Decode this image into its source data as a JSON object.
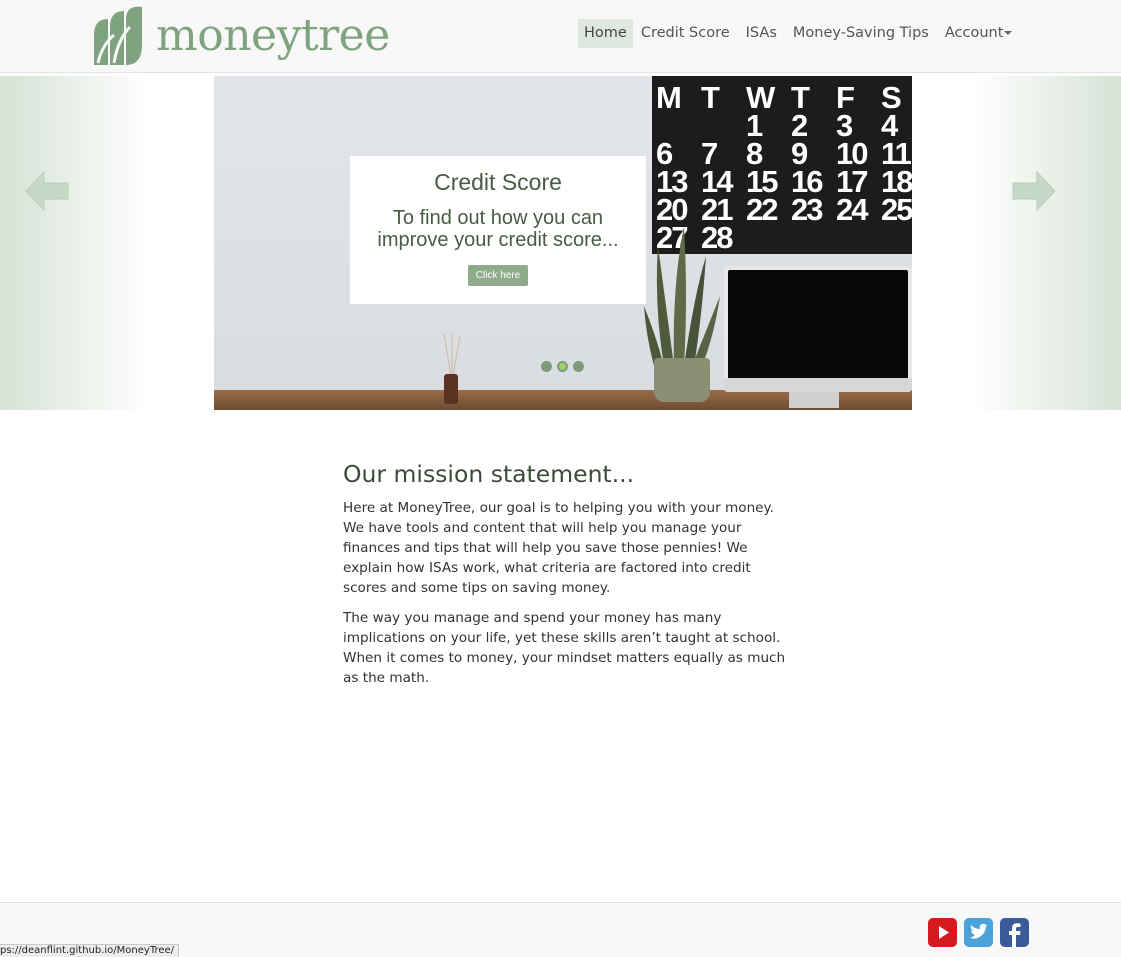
{
  "brand": {
    "name": "moneytree",
    "accent": "#7fa37f"
  },
  "nav": {
    "items": [
      {
        "label": "Home",
        "active": true
      },
      {
        "label": "Credit Score",
        "active": false
      },
      {
        "label": "ISAs",
        "active": false
      },
      {
        "label": "Money-Saving Tips",
        "active": false
      }
    ],
    "account_label": "Account"
  },
  "carousel": {
    "caption_title": "Credit Score",
    "caption_text": "To find out how you can improve your credit score...",
    "button_label": "Click here",
    "slide_count": 3,
    "active_slide": 2,
    "calendar_days": [
      "M",
      "T",
      "W",
      "T",
      "F",
      "S",
      "",
      "",
      "1",
      "2",
      "3",
      "4",
      "6",
      "7",
      "8",
      "9",
      "10",
      "11",
      "13",
      "14",
      "15",
      "16",
      "17",
      "18",
      "20",
      "21",
      "22",
      "23",
      "24",
      "25",
      "27",
      "28",
      "",
      "",
      "",
      ""
    ]
  },
  "mission": {
    "heading": "Our mission statement...",
    "paragraph1": "Here at MoneyTree, our goal is to helping you with your money. We have tools and content that will help you manage your finances and tips that will help you save those pennies! We explain how ISAs work, what criteria are factored into credit scores and some tips on saving money.",
    "paragraph2": "The way you manage and spend your money has many implications on your life, yet these skills aren’t taught at school. When it comes to money, your mindset matters equally as much as the math."
  },
  "footer": {
    "social": [
      "youtube-icon",
      "twitter-icon",
      "facebook-icon"
    ]
  },
  "status_bar": {
    "url": "ps://deanflint.github.io/MoneyTree/"
  }
}
